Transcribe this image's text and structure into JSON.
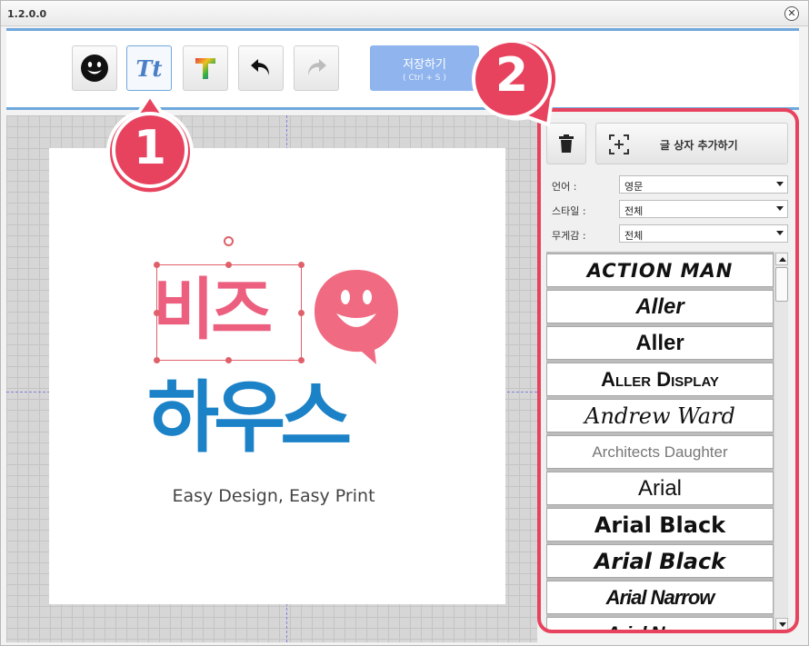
{
  "window": {
    "version": "1.2.0.0",
    "close_glyph": "✕"
  },
  "toolbar": {
    "save_label": "저장하기",
    "save_hint": "( Ctrl + S )",
    "text_tool_label": "Tt"
  },
  "canvas": {
    "logo_top": "비즈",
    "logo_bottom": "하우스",
    "tagline": "Easy Design, Easy Print"
  },
  "markers": {
    "one": "1",
    "two": "2"
  },
  "panel": {
    "add_text_label": "글 상자 추가하기",
    "filters": [
      {
        "label": "언어 :",
        "value": "영문"
      },
      {
        "label": "스타일 :",
        "value": "전체"
      },
      {
        "label": "무게감 :",
        "value": "전체"
      }
    ],
    "fonts": [
      {
        "name": "ACTION MAN"
      },
      {
        "name": "Aller"
      },
      {
        "name": "Aller"
      },
      {
        "name": "Aller Display"
      },
      {
        "name": "Andrew Ward"
      },
      {
        "name": "Architects Daughter"
      },
      {
        "name": "Arial"
      },
      {
        "name": "Arial Black"
      },
      {
        "name": "Arial Black"
      },
      {
        "name": "Arial Narrow"
      },
      {
        "name": "Arial Narrow"
      }
    ]
  },
  "colors": {
    "accent": "#e8435e",
    "brand_pink": "#ec5f7f",
    "brand_blue": "#1c82c8",
    "save_blue": "#8fb4ee"
  },
  "icons": [
    "smiley-icon",
    "text-style-icon",
    "gradient-text-icon",
    "undo-icon",
    "redo-icon",
    "trash-icon",
    "add-text-box-icon"
  ]
}
